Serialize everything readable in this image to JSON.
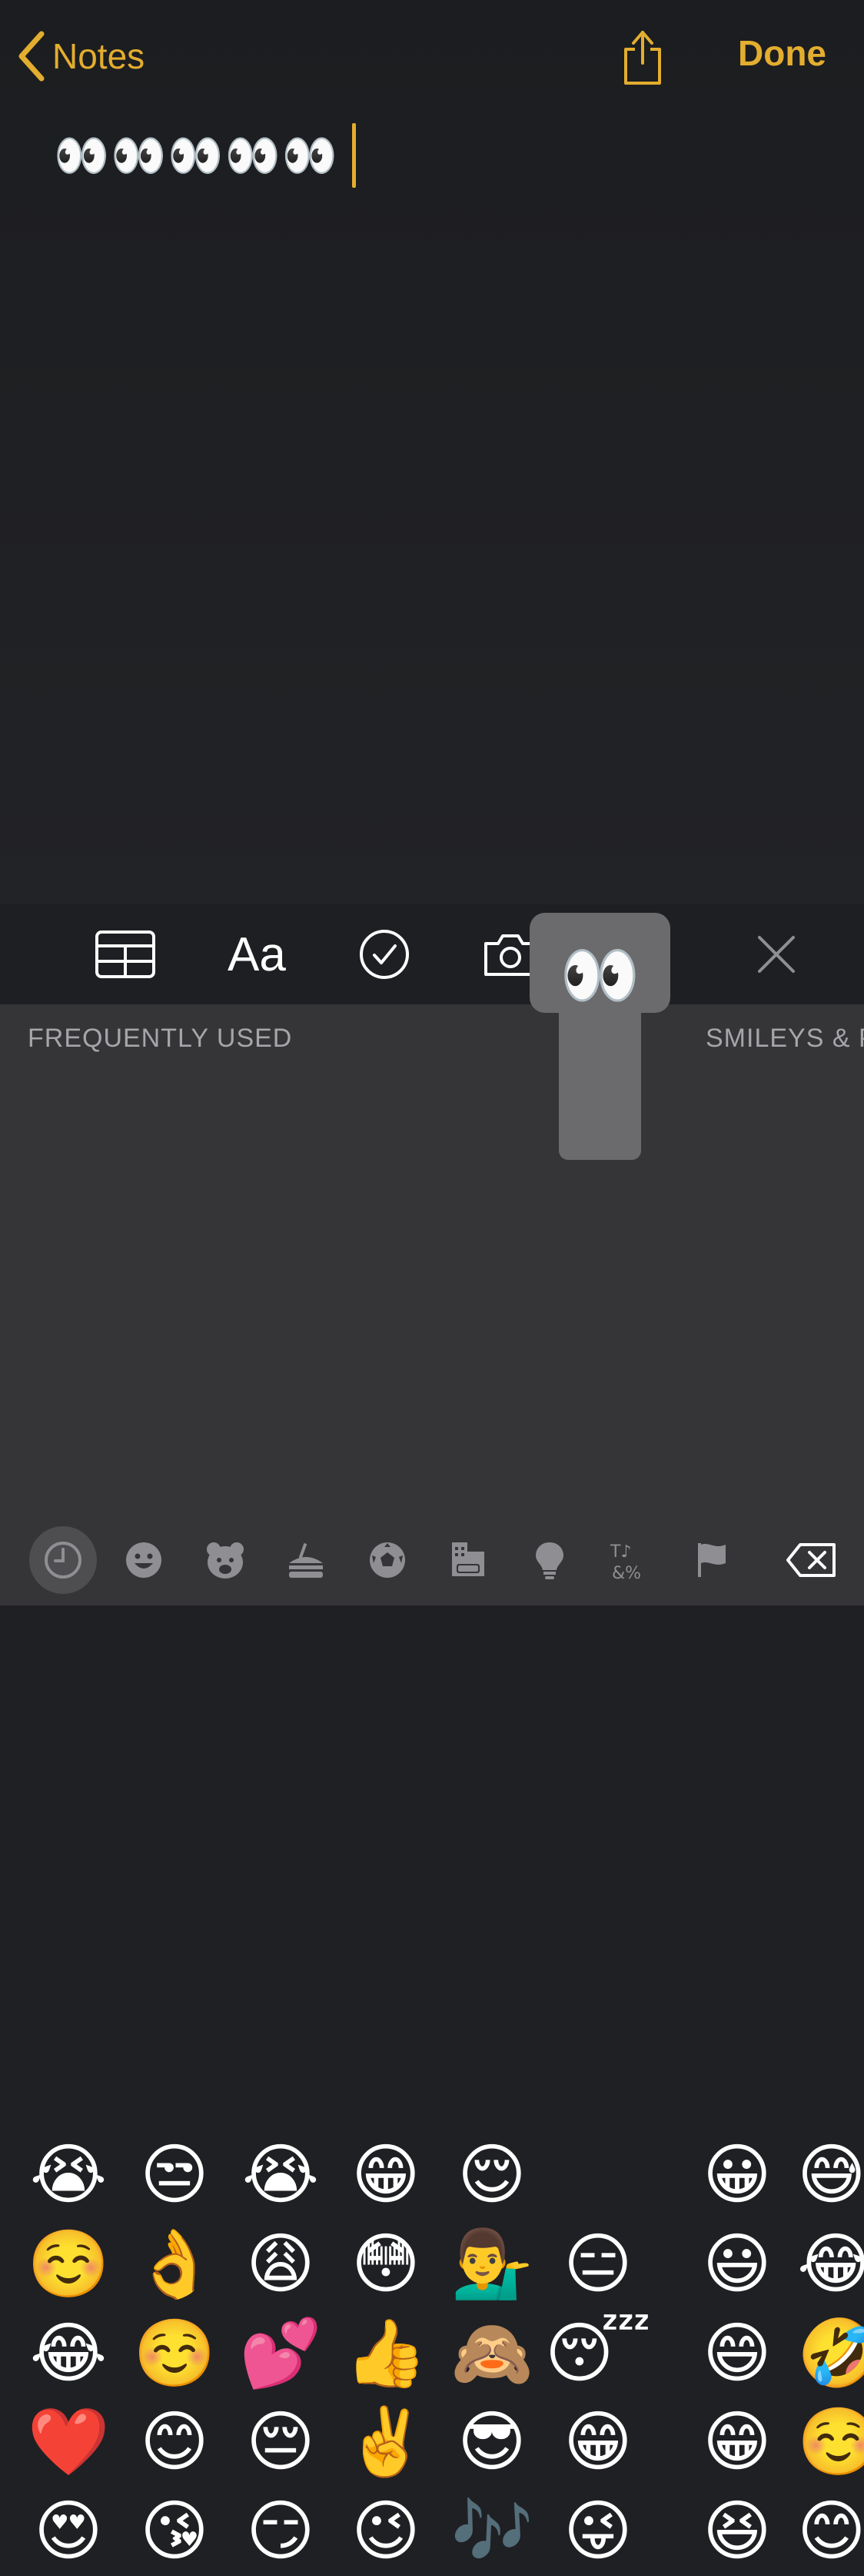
{
  "nav": {
    "back_label": "Notes",
    "done_label": "Done"
  },
  "note": {
    "text": "👀👀👀👀👀"
  },
  "toolbar": {
    "format_label": "Aa"
  },
  "keyboard": {
    "section_frequently_used": "FREQUENTLY USED",
    "section_smileys": "SMILEYS & P",
    "popup_emoji": "👀",
    "frequently_used_columns": [
      [
        "😭",
        "☺️",
        "😂",
        "❤️",
        "😍"
      ],
      [
        "😒",
        "👌",
        "☺️",
        "😊",
        "😘"
      ],
      [
        "😭",
        "😩",
        "💕",
        "😔",
        "😏"
      ],
      [
        "😁",
        "😳",
        "👍",
        "✌️",
        "😉"
      ],
      [
        "😌",
        "💁‍♂️",
        "🙈",
        "😎",
        "🎶"
      ],
      [
        "",
        "😑",
        "😴",
        "😁",
        "😜"
      ]
    ],
    "smileys_columns": [
      [
        "😀",
        "😃",
        "😄",
        "😁",
        "😆"
      ],
      [
        "😅",
        "😂",
        "🤣",
        "☺️",
        "😊"
      ]
    ]
  },
  "categories": [
    "recent",
    "smileys",
    "animals",
    "food",
    "activity",
    "travel",
    "objects",
    "symbols",
    "flags"
  ],
  "colors": {
    "accent": "#e3ad2f",
    "keyboard_bg": "#353537",
    "note_bg": "#1f2023"
  }
}
